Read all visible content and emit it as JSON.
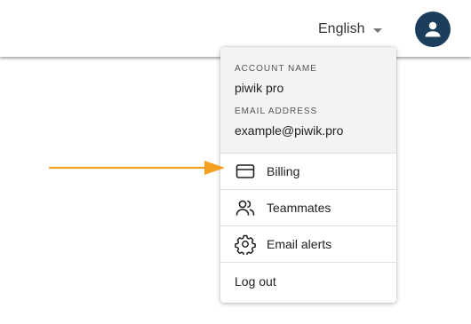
{
  "header": {
    "language": "English",
    "language_caret_icon": "caret-down-icon",
    "avatar_icon": "user-avatar-icon",
    "avatar_color": "#1a3e5c"
  },
  "account_menu": {
    "account_name_label": "ACCOUNT NAME",
    "account_name": "piwik pro",
    "email_label": "EMAIL ADDRESS",
    "email": "example@piwik.pro",
    "items": [
      {
        "label": "Billing",
        "icon": "credit-card-icon"
      },
      {
        "label": "Teammates",
        "icon": "people-icon"
      },
      {
        "label": "Email alerts",
        "icon": "gear-icon"
      },
      {
        "label": "Log out",
        "icon": ""
      }
    ]
  },
  "annotation": {
    "arrow_color": "#f5a01e"
  }
}
